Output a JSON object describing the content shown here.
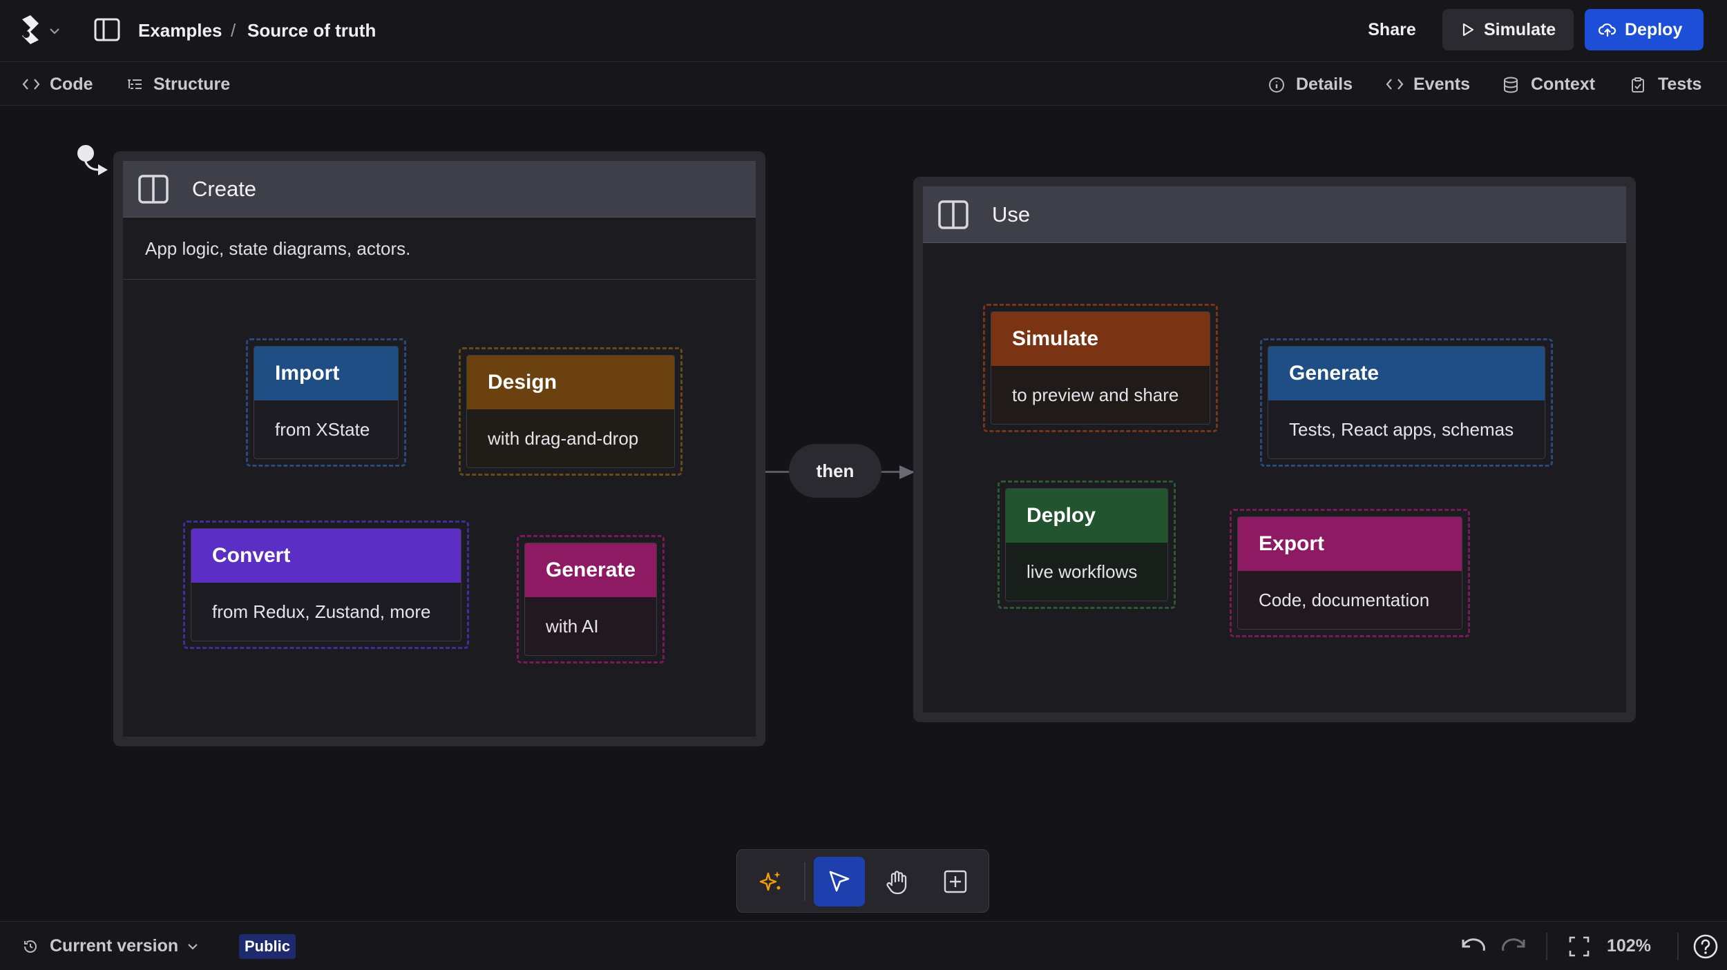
{
  "header": {
    "breadcrumb_root": "Examples",
    "breadcrumb_sep": "/",
    "breadcrumb_current": "Source of truth",
    "share_label": "Share",
    "simulate_label": "Simulate",
    "deploy_label": "Deploy"
  },
  "subbar": {
    "left_tabs": [
      {
        "label": "Code",
        "icon": "code-icon"
      },
      {
        "label": "Structure",
        "icon": "structure-icon"
      }
    ],
    "right_tabs": [
      {
        "label": "Details",
        "icon": "info-icon"
      },
      {
        "label": "Events",
        "icon": "code-icon"
      },
      {
        "label": "Context",
        "icon": "database-icon"
      },
      {
        "label": "Tests",
        "icon": "clipboard-icon"
      }
    ]
  },
  "diagram": {
    "create": {
      "title": "Create",
      "description": "App logic, state diagrams, actors.",
      "nodes": [
        {
          "title": "Import",
          "body": "from XState",
          "color": "#1f4e85"
        },
        {
          "title": "Design",
          "body": "with drag-and-drop",
          "color": "#6b4110"
        },
        {
          "title": "Convert",
          "body": "from Redux, Zustand, more",
          "color": "#5b2fc4"
        },
        {
          "title": "Generate",
          "body": "with AI",
          "color": "#8e1a63"
        }
      ]
    },
    "transition_label": "then",
    "use": {
      "title": "Use",
      "nodes": [
        {
          "title": "Simulate",
          "body": "to preview and share",
          "color": "#7a3413"
        },
        {
          "title": "Generate",
          "body": "Tests, React apps, schemas",
          "color": "#1f4e85"
        },
        {
          "title": "Deploy",
          "body": "live workflows",
          "color": "#22552f"
        },
        {
          "title": "Export",
          "body": "Code, documentation",
          "color": "#8e1a63"
        }
      ]
    }
  },
  "tools": [
    "sparkles-icon",
    "pointer-icon",
    "hand-icon",
    "add-state-icon"
  ],
  "footer": {
    "version_label": "Current version",
    "visibility_badge": "Public",
    "zoom_level": "102%"
  },
  "colors": {
    "accent": "#1d4ed8",
    "background": "#141418"
  }
}
